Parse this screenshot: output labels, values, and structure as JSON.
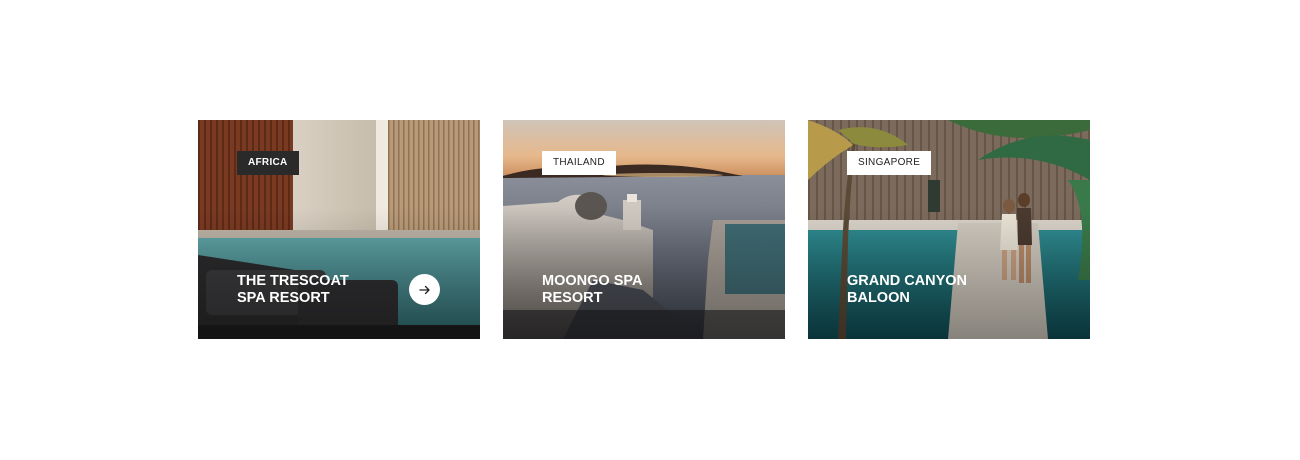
{
  "cards": [
    {
      "badge": "AFRICA",
      "title_line1": "THE TRESCOAT",
      "title_line2": "SPA RESORT",
      "image": "spa-pool-photo",
      "action_icon": "arrow-right-icon"
    },
    {
      "badge": "THAILAND",
      "title_line1": "MOONGO SPA",
      "title_line2": "RESORT",
      "image": "sunset-sea-terrace-photo"
    },
    {
      "badge": "SINGAPORE",
      "title_line1": "GRAND CANYON",
      "title_line2": "BALOON",
      "image": "palm-pool-couple-photo"
    }
  ],
  "colors": {
    "badge_dark": "#2a2a2a",
    "badge_light": "#ffffff",
    "title_text": "#ffffff"
  }
}
